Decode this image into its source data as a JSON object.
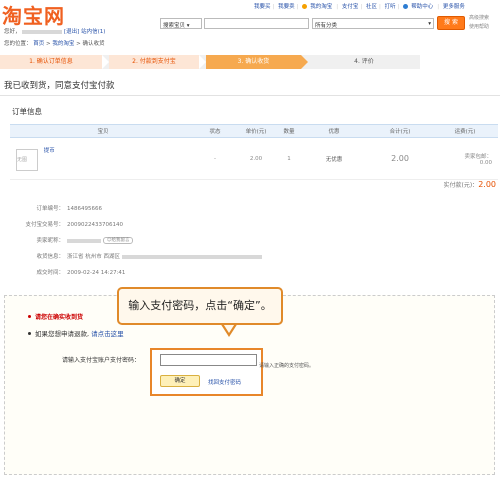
{
  "brand": {
    "logo": "淘宝网"
  },
  "top_links": [
    "我要买",
    "我要卖",
    "我的淘宝",
    "支付宝",
    "社区",
    "打听",
    "帮助中心",
    "更多服务"
  ],
  "header": {
    "welcome": "您好，",
    "logout": "[退出]",
    "messages": "站内信(1)",
    "breadcrumb_prefix": "您的位置：",
    "breadcrumb_home": "首页",
    "breadcrumb_mytaobao": "我的淘宝",
    "breadcrumb_current": "确认收货"
  },
  "search": {
    "scope": "搜索宝贝",
    "category": "所有分类",
    "button": "搜 索",
    "advanced": "高级搜索",
    "help": "使用帮助"
  },
  "steps": [
    "1. 确认订单信息",
    "2. 付款到支付宝",
    "3. 确认收货",
    "4. 评价"
  ],
  "page_title": "我已收到货，同意支付宝付款",
  "order_section": "订单信息",
  "table": {
    "headers": [
      "宝贝",
      "状态",
      "单价(元)",
      "数量",
      "优惠",
      "合计(元)",
      "运费(元)"
    ],
    "row": {
      "thumb": "无图",
      "name": "提币",
      "status": "-",
      "price": "2.00",
      "qty": "1",
      "discount": "无优惠",
      "total": "2.00",
      "shipping_label": "卖家包邮：",
      "shipping": "0.00"
    }
  },
  "total": {
    "label": "实付款(元)：",
    "value": "2.00"
  },
  "info": {
    "order_no_label": "订单编号：",
    "order_no": "1486495666",
    "alipay_no_label": "支付宝交易号：",
    "alipay_no": "2009022433706140",
    "seller_label": "卖家昵称：",
    "wangwang": "给我留言",
    "address_label": "收货信息：",
    "address": "浙江省 杭州市 西湖区",
    "time_label": "成交时间：",
    "time": "2009-02-24 14:27:41"
  },
  "notice": {
    "warn": "请您在确实收到货",
    "refund_text": "如果您想申请退款,",
    "refund_link": "请点击这里"
  },
  "password": {
    "label": "请输入支付宝账户支付密码：",
    "hint": "请输入正确的支付密码。",
    "ok": "确定",
    "forgot": "找回支付密码"
  },
  "callout": "输入支付密码，点击“确定”。",
  "colors": {
    "accent": "#ff6600",
    "link": "#2550a8",
    "callout_border": "#e08a2a"
  }
}
